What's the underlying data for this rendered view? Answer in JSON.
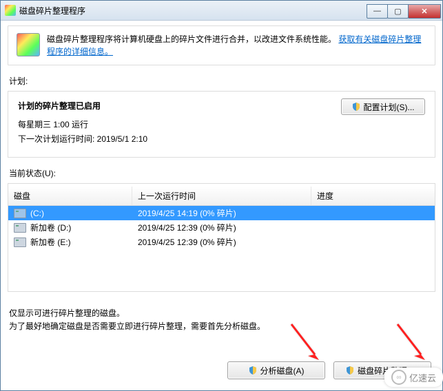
{
  "window": {
    "title": "磁盘碎片整理程序"
  },
  "info": {
    "text": "磁盘碎片整理程序将计算机硬盘上的碎片文件进行合并，以改进文件系统性能。",
    "link": "获取有关磁盘碎片整理程序的详细信息。"
  },
  "schedule": {
    "label": "计划:",
    "heading": "计划的碎片整理已启用",
    "line1": "每星期三  1:00 运行",
    "line2": "下一次计划运行时间: 2019/5/1 2:10",
    "configure_btn": "配置计划(S)..."
  },
  "status": {
    "label": "当前状态(U):"
  },
  "list": {
    "headers": {
      "disk": "磁盘",
      "last": "上一次运行时间",
      "progress": "进度"
    },
    "rows": [
      {
        "name": "(C:)",
        "last": "2019/4/25 14:19 (0% 碎片)",
        "progress": "",
        "sel": true,
        "icon": "c"
      },
      {
        "name": "新加卷 (D:)",
        "last": "2019/4/25 12:39 (0% 碎片)",
        "progress": "",
        "sel": false,
        "icon": "d"
      },
      {
        "name": "新加卷 (E:)",
        "last": "2019/4/25 12:39 (0% 碎片)",
        "progress": "",
        "sel": false,
        "icon": "d"
      }
    ]
  },
  "hints": {
    "line1": "仅显示可进行碎片整理的磁盘。",
    "line2": "为了最好地确定磁盘是否需要立即进行碎片整理，需要首先分析磁盘。"
  },
  "actions": {
    "analyze": "分析磁盘(A)",
    "defrag": "磁盘碎片整理(D)"
  },
  "watermark": "亿速云"
}
